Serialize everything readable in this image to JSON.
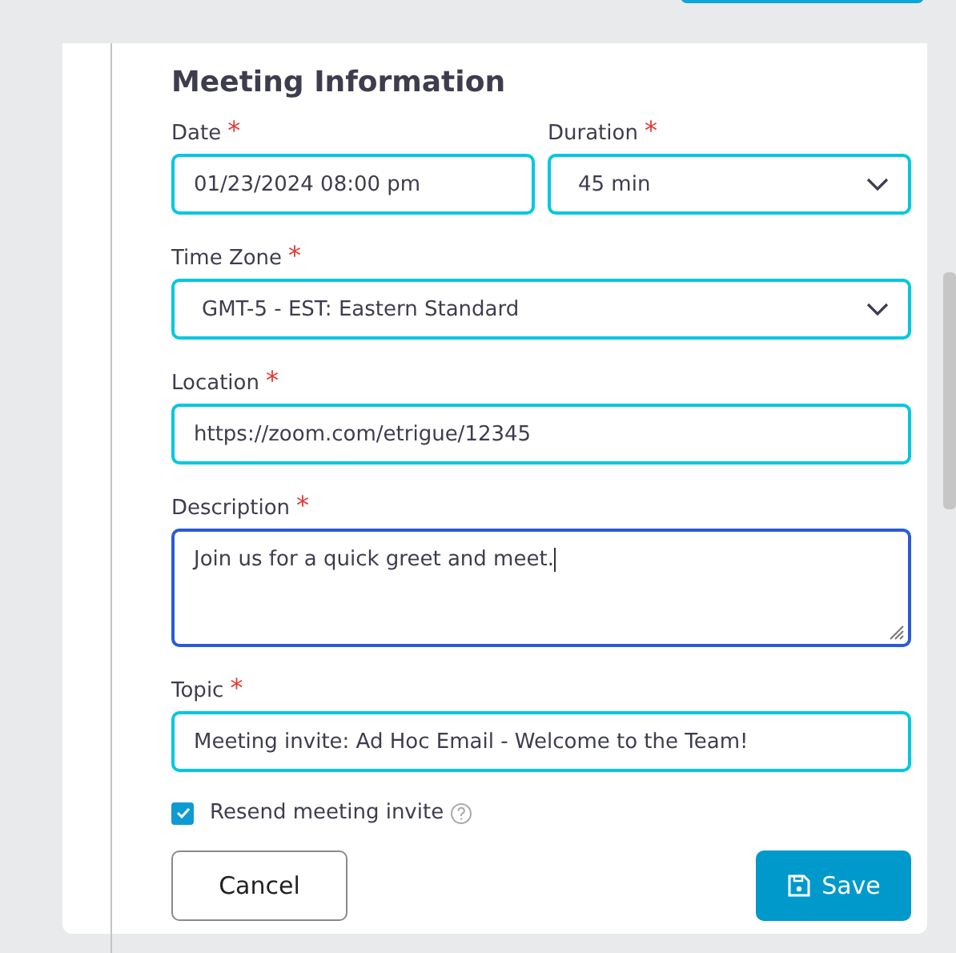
{
  "title": "Meeting Information",
  "rows": [
    [
      {
        "kind": "input",
        "label": "Date",
        "marker": "*",
        "value": "01/23/2024 08:00 pm",
        "focused": false
      },
      {
        "kind": "select",
        "label": "Duration",
        "marker": "*",
        "value": "45 min",
        "focused": false
      }
    ],
    [
      {
        "kind": "select",
        "label": "Time Zone",
        "marker": "*",
        "value": "GMT-5 - EST: Eastern Standard",
        "focused": false
      }
    ],
    [
      {
        "kind": "input",
        "label": "Location",
        "marker": "*",
        "value": "https://zoom.com/etrigue/12345",
        "focused": false
      }
    ],
    [
      {
        "kind": "textarea",
        "label": "Description",
        "marker": "*",
        "value": "Join us for a quick greet and meet.",
        "focused": true
      }
    ],
    [
      {
        "kind": "input",
        "label": "Topic",
        "marker": "*",
        "value": "Meeting invite: Ad Hoc Email - Welcome to the Team!",
        "focused": false
      }
    ]
  ],
  "resend": {
    "label": "Resend meeting invite",
    "checked": true
  },
  "buttons": [
    {
      "kind": "secondary",
      "label": "Cancel"
    },
    {
      "kind": "primary",
      "label": "Save"
    }
  ]
}
